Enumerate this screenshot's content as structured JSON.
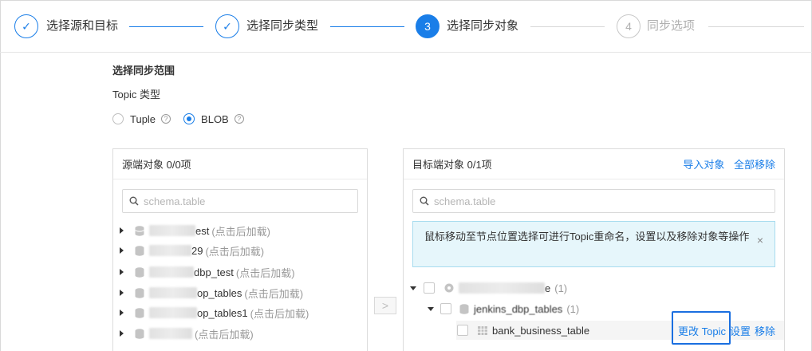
{
  "steps": [
    {
      "number": "✓",
      "label": "选择源和目标",
      "state": "done"
    },
    {
      "number": "✓",
      "label": "选择同步类型",
      "state": "done"
    },
    {
      "number": "3",
      "label": "选择同步对象",
      "state": "active"
    },
    {
      "number": "4",
      "label": "同步选项",
      "state": "todo"
    }
  ],
  "section_title": "选择同步范围",
  "topic_type_label": "Topic 类型",
  "radios": [
    {
      "label": "Tuple",
      "checked": false
    },
    {
      "label": "BLOB",
      "checked": true
    }
  ],
  "help_glyph": "?",
  "source_panel": {
    "title": "源端对象  0/0项",
    "search_placeholder": "schema.table",
    "items": [
      {
        "visible_text": "est",
        "hint": "(点击后加载)"
      },
      {
        "visible_text": "29",
        "hint": "(点击后加载)"
      },
      {
        "visible_text": "dbp_test",
        "hint": "(点击后加载)"
      },
      {
        "visible_text": "op_tables",
        "hint": "(点击后加载)"
      },
      {
        "visible_text": "op_tables1",
        "hint": "(点击后加载)"
      },
      {
        "visible_text": "",
        "hint": "(点击后加载)"
      }
    ]
  },
  "transfer_button": ">",
  "target_panel": {
    "title": "目标端对象  0/1项",
    "actions": {
      "import": "导入对象",
      "remove_all": "全部移除"
    },
    "search_placeholder": "schema.table",
    "info_text": "鼠标移动至节点位置选择可进行Topic重命名，设置以及移除对象等操作",
    "info_close": "×",
    "tree": {
      "root": {
        "visible_text": "e",
        "count": "(1)"
      },
      "schema": {
        "visible_text": "jenkins_dbp_tables",
        "count": "(1)"
      },
      "table": {
        "name": "bank_business_table"
      },
      "row_actions": {
        "change_topic": "更改 Topic",
        "settings": "设置",
        "remove": "移除"
      }
    }
  },
  "colors": {
    "accent": "#1a7ee8",
    "highlight": "#1a6fe0",
    "info_bg": "#e6f6fb"
  }
}
